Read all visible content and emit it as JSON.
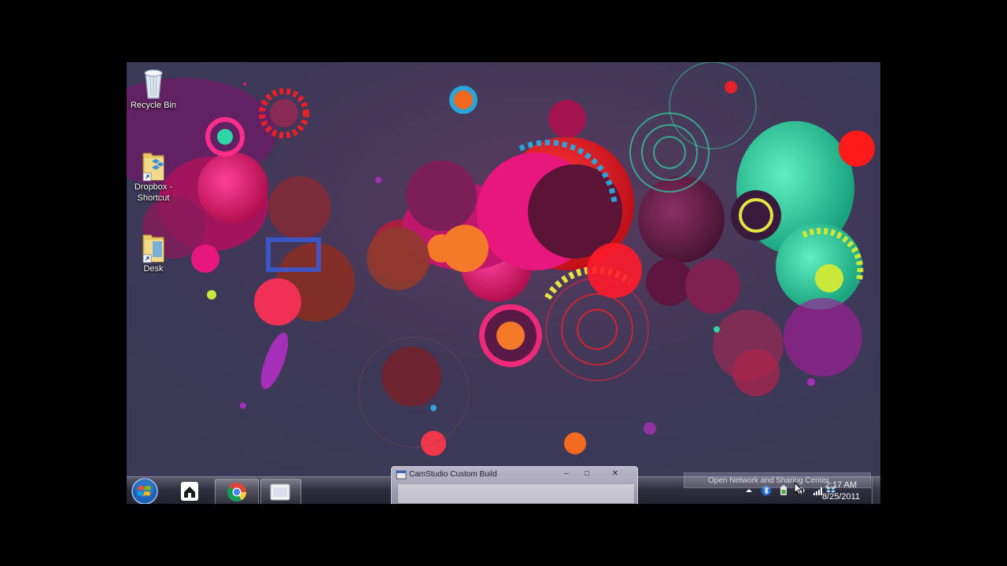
{
  "desktop": {
    "icons": [
      {
        "label": "Recycle Bin",
        "icon": "recycle-bin-icon"
      },
      {
        "label": "Dropbox -\nShortcut",
        "label_line1": "Dropbox -",
        "label_line2": "Shortcut",
        "icon": "dropbox-folder-icon"
      },
      {
        "label": "Desk",
        "icon": "folder-icon"
      }
    ]
  },
  "taskbar": {
    "start_icon": "windows-orb-icon",
    "pinned": [
      {
        "name": "home-server-icon"
      },
      {
        "name": "chrome-icon"
      },
      {
        "name": "window-app-icon"
      }
    ],
    "thumbnail": {
      "title": "CamStudio Custom Build",
      "minimize": "–",
      "maximize": "□",
      "close": "✕"
    },
    "tray": {
      "tooltip": "Open Network and Sharing Center",
      "time": "2:17 AM",
      "date": "8/25/2011",
      "icons": [
        "show-hidden-icons-arrow",
        "bluetooth-icon",
        "power-icon",
        "volume-icon",
        "network-icon",
        "dropbox-tray-icon"
      ]
    }
  },
  "colors": {
    "wallpaper_base": "#3b3554",
    "magenta": "#e8177d",
    "red": "#e8202a",
    "teal": "#2fd7a6",
    "purple": "#7b2a7f"
  }
}
